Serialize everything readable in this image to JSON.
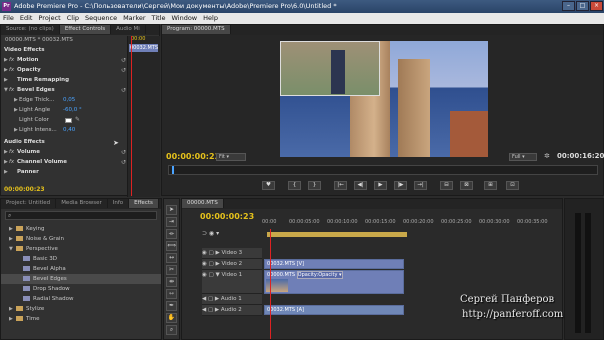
{
  "window": {
    "title": "Adobe Premiere Pro - C:\\Пользователи\\Сергей\\Мои документы\\Adobe\\Premiere Pro\\6.0\\Untitled *",
    "app_icon": "Pr"
  },
  "menu": [
    "File",
    "Edit",
    "Project",
    "Clip",
    "Sequence",
    "Marker",
    "Title",
    "Window",
    "Help"
  ],
  "source_panel": {
    "tabs": [
      "Source: (no clips)",
      "Effect Controls",
      "Audio Mi"
    ],
    "clip_header": "00000.MTS * 00032.MTS",
    "ruler_time": "00:00",
    "clip_label": "00032.MTS",
    "video_effects": "Video Effects",
    "rows": [
      {
        "label": "Motion",
        "fx": "fx"
      },
      {
        "label": "Opacity",
        "fx": "fx"
      },
      {
        "label": "Time Remapping",
        "fx": ""
      },
      {
        "label": "Bevel Edges",
        "fx": "fx"
      }
    ],
    "params": [
      {
        "label": "Edge Thick...",
        "value": "0,05"
      },
      {
        "label": "Light Angle",
        "value": "-60,0 °"
      },
      {
        "label": "Light Color",
        "value": ""
      },
      {
        "label": "Light Intens...",
        "value": "0,40"
      }
    ],
    "audio_effects": "Audio Effects",
    "audio_rows": [
      {
        "label": "Volume",
        "fx": "fx"
      },
      {
        "label": "Channel Volume",
        "fx": "fx"
      },
      {
        "label": "Panner",
        "fx": ""
      }
    ],
    "bottom_time": "00:00:00:23"
  },
  "program_panel": {
    "tab": "Program: 00000.MTS",
    "current_time": "00:00:00:23",
    "fit": "Fit",
    "quality": "Full",
    "duration": "00:00:16:20"
  },
  "transport": [
    "♥",
    "{",
    "}",
    "|←",
    "◀|",
    "▶",
    "|▶",
    "→|",
    "⊟",
    "⊠",
    "⊞",
    "⊡"
  ],
  "effects_panel": {
    "tabs": [
      "Project: Untitled",
      "Media Browser",
      "Info",
      "Effects"
    ],
    "items": [
      {
        "label": "Keying",
        "type": "folder",
        "indent": 1
      },
      {
        "label": "Noise & Grain",
        "type": "folder",
        "indent": 1
      },
      {
        "label": "Perspective",
        "type": "folder",
        "indent": 1,
        "open": true
      },
      {
        "label": "Basic 3D",
        "type": "fx",
        "indent": 2
      },
      {
        "label": "Bevel Alpha",
        "type": "fx",
        "indent": 2
      },
      {
        "label": "Bevel Edges",
        "type": "fx",
        "indent": 2,
        "selected": true
      },
      {
        "label": "Drop Shadow",
        "type": "fx",
        "indent": 2
      },
      {
        "label": "Radial Shadow",
        "type": "fx",
        "indent": 2
      },
      {
        "label": "Stylize",
        "type": "folder",
        "indent": 1
      },
      {
        "label": "Time",
        "type": "folder",
        "indent": 1
      }
    ]
  },
  "timeline": {
    "tab": "00000.MTS",
    "current_time": "00:00:00:23",
    "ruler": [
      "00:00",
      "00:00:05:00",
      "00:00:10:00",
      "00:00:15:00",
      "00:00:20:00",
      "00:00:25:00",
      "00:00:30:00",
      "00:00:35:00"
    ],
    "tracks": [
      {
        "name": "Video 3",
        "kind": "video"
      },
      {
        "name": "Video 2",
        "kind": "video"
      },
      {
        "name": "Video 1",
        "kind": "video"
      },
      {
        "name": "Audio 1",
        "kind": "audio"
      },
      {
        "name": "Audio 2",
        "kind": "audio"
      }
    ],
    "clip_v2": "00032.MTS [V]",
    "clip_v1": "00000.MTS",
    "clip_v1_fx": "Opacity:Opacity ▾",
    "clip_a2": "00032.MTS [A]"
  },
  "watermark": {
    "line1": "Сергей Панферов",
    "line2": "http://panferoff.com"
  }
}
